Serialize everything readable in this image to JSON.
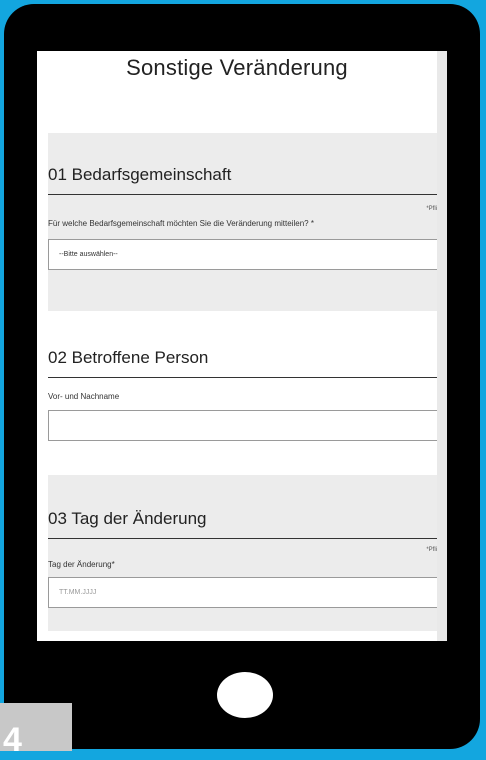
{
  "page": {
    "title": "Sonstige Veränderung"
  },
  "sections": [
    {
      "title": "01 Bedarfsgemeinschaft",
      "required_note": "*Pfli",
      "field_label": "Für welche Bedarfsgemeinschaft möchten Sie die Veränderung mitteilen? *",
      "select_value": "--Bitte auswählen--"
    },
    {
      "title": "02 Betroffene Person",
      "field_label": "Vor- und Nachname",
      "input_value": ""
    },
    {
      "title": "03 Tag der Änderung",
      "required_note": "*Pfli",
      "field_label": "Tag der Änderung*",
      "input_placeholder": "TT.MM.JJJJ"
    }
  ],
  "step_badge": "4",
  "colors": {
    "background": "#13a6df",
    "phone": "#000000",
    "section_gray": "#ececec"
  }
}
